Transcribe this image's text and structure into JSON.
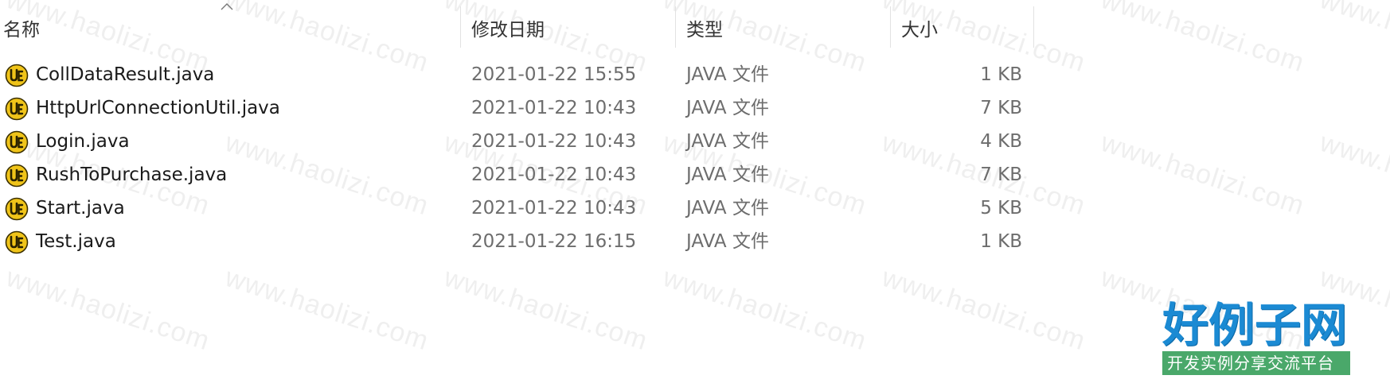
{
  "columns": {
    "name": "名称",
    "date": "修改日期",
    "type": "类型",
    "size": "大小"
  },
  "files": [
    {
      "name": "CollDataResult.java",
      "date": "2021-01-22 15:55",
      "type": "JAVA 文件",
      "size": "1 KB",
      "icon": "ue-java-file-icon"
    },
    {
      "name": "HttpUrlConnectionUtil.java",
      "date": "2021-01-22 10:43",
      "type": "JAVA 文件",
      "size": "7 KB",
      "icon": "ue-java-file-icon"
    },
    {
      "name": "Login.java",
      "date": "2021-01-22 10:43",
      "type": "JAVA 文件",
      "size": "4 KB",
      "icon": "ue-java-file-icon"
    },
    {
      "name": "RushToPurchase.java",
      "date": "2021-01-22 10:43",
      "type": "JAVA 文件",
      "size": "7 KB",
      "icon": "ue-java-file-icon"
    },
    {
      "name": "Start.java",
      "date": "2021-01-22 10:43",
      "type": "JAVA 文件",
      "size": "5 KB",
      "icon": "ue-java-file-icon"
    },
    {
      "name": "Test.java",
      "date": "2021-01-22 16:15",
      "type": "JAVA 文件",
      "size": "1 KB",
      "icon": "ue-java-file-icon"
    }
  ],
  "watermark": {
    "text": "www.haolizi.com"
  },
  "logo": {
    "title": "好例子网",
    "subtitle": "开发实例分享交流平台"
  },
  "colors": {
    "icon_fill": "#f0c419",
    "icon_stroke": "#3a2f00",
    "logo_blue": "#1b8ad3",
    "logo_green": "#4aa86a"
  }
}
